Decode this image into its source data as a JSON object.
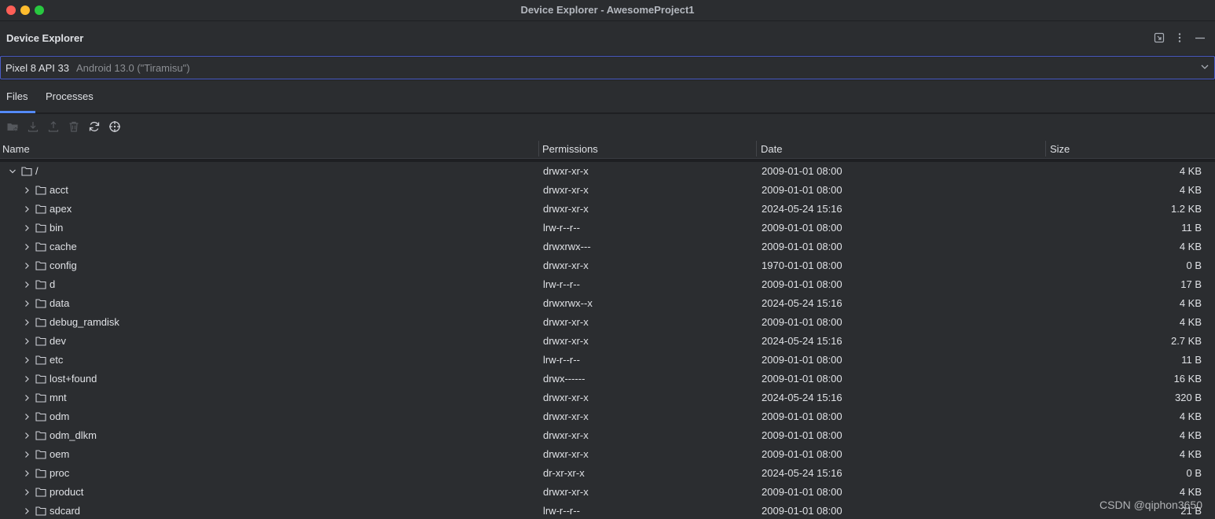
{
  "window": {
    "title": "Device Explorer - AwesomeProject1"
  },
  "tool": {
    "title": "Device Explorer",
    "icons": [
      "expand-icon",
      "more-vertical-icon",
      "minimize-icon"
    ]
  },
  "device": {
    "name": "Pixel 8 API 33",
    "detail": "Android 13.0 (\"Tiramisu\")"
  },
  "tabs": [
    {
      "label": "Files",
      "selected": true
    },
    {
      "label": "Processes",
      "selected": false
    }
  ],
  "actions": [
    {
      "icon": "new-folder-icon",
      "enabled": false
    },
    {
      "icon": "download-icon",
      "enabled": false
    },
    {
      "icon": "upload-icon",
      "enabled": false
    },
    {
      "icon": "trash-icon",
      "enabled": false
    },
    {
      "icon": "sync-icon",
      "enabled": true
    },
    {
      "icon": "locate-icon",
      "enabled": true
    }
  ],
  "columns": {
    "name": "Name",
    "permissions": "Permissions",
    "date": "Date",
    "size": "Size"
  },
  "files": [
    {
      "name": "/",
      "permissions": "drwxr-xr-x",
      "date": "2009-01-01 08:00",
      "size": "4 KB",
      "level": 0,
      "expanded": true
    },
    {
      "name": "acct",
      "permissions": "drwxr-xr-x",
      "date": "2009-01-01 08:00",
      "size": "4 KB",
      "level": 1,
      "expanded": false
    },
    {
      "name": "apex",
      "permissions": "drwxr-xr-x",
      "date": "2024-05-24 15:16",
      "size": "1.2 KB",
      "level": 1,
      "expanded": false
    },
    {
      "name": "bin",
      "permissions": "lrw-r--r--",
      "date": "2009-01-01 08:00",
      "size": "11 B",
      "level": 1,
      "expanded": false
    },
    {
      "name": "cache",
      "permissions": "drwxrwx---",
      "date": "2009-01-01 08:00",
      "size": "4 KB",
      "level": 1,
      "expanded": false
    },
    {
      "name": "config",
      "permissions": "drwxr-xr-x",
      "date": "1970-01-01 08:00",
      "size": "0 B",
      "level": 1,
      "expanded": false
    },
    {
      "name": "d",
      "permissions": "lrw-r--r--",
      "date": "2009-01-01 08:00",
      "size": "17 B",
      "level": 1,
      "expanded": false
    },
    {
      "name": "data",
      "permissions": "drwxrwx--x",
      "date": "2024-05-24 15:16",
      "size": "4 KB",
      "level": 1,
      "expanded": false
    },
    {
      "name": "debug_ramdisk",
      "permissions": "drwxr-xr-x",
      "date": "2009-01-01 08:00",
      "size": "4 KB",
      "level": 1,
      "expanded": false
    },
    {
      "name": "dev",
      "permissions": "drwxr-xr-x",
      "date": "2024-05-24 15:16",
      "size": "2.7 KB",
      "level": 1,
      "expanded": false
    },
    {
      "name": "etc",
      "permissions": "lrw-r--r--",
      "date": "2009-01-01 08:00",
      "size": "11 B",
      "level": 1,
      "expanded": false
    },
    {
      "name": "lost+found",
      "permissions": "drwx------",
      "date": "2009-01-01 08:00",
      "size": "16 KB",
      "level": 1,
      "expanded": false
    },
    {
      "name": "mnt",
      "permissions": "drwxr-xr-x",
      "date": "2024-05-24 15:16",
      "size": "320 B",
      "level": 1,
      "expanded": false
    },
    {
      "name": "odm",
      "permissions": "drwxr-xr-x",
      "date": "2009-01-01 08:00",
      "size": "4 KB",
      "level": 1,
      "expanded": false
    },
    {
      "name": "odm_dlkm",
      "permissions": "drwxr-xr-x",
      "date": "2009-01-01 08:00",
      "size": "4 KB",
      "level": 1,
      "expanded": false
    },
    {
      "name": "oem",
      "permissions": "drwxr-xr-x",
      "date": "2009-01-01 08:00",
      "size": "4 KB",
      "level": 1,
      "expanded": false
    },
    {
      "name": "proc",
      "permissions": "dr-xr-xr-x",
      "date": "2024-05-24 15:16",
      "size": "0 B",
      "level": 1,
      "expanded": false
    },
    {
      "name": "product",
      "permissions": "drwxr-xr-x",
      "date": "2009-01-01 08:00",
      "size": "4 KB",
      "level": 1,
      "expanded": false
    },
    {
      "name": "sdcard",
      "permissions": "lrw-r--r--",
      "date": "2009-01-01 08:00",
      "size": "21 B",
      "level": 1,
      "expanded": false
    }
  ],
  "watermark": "CSDN @qiphon3650"
}
